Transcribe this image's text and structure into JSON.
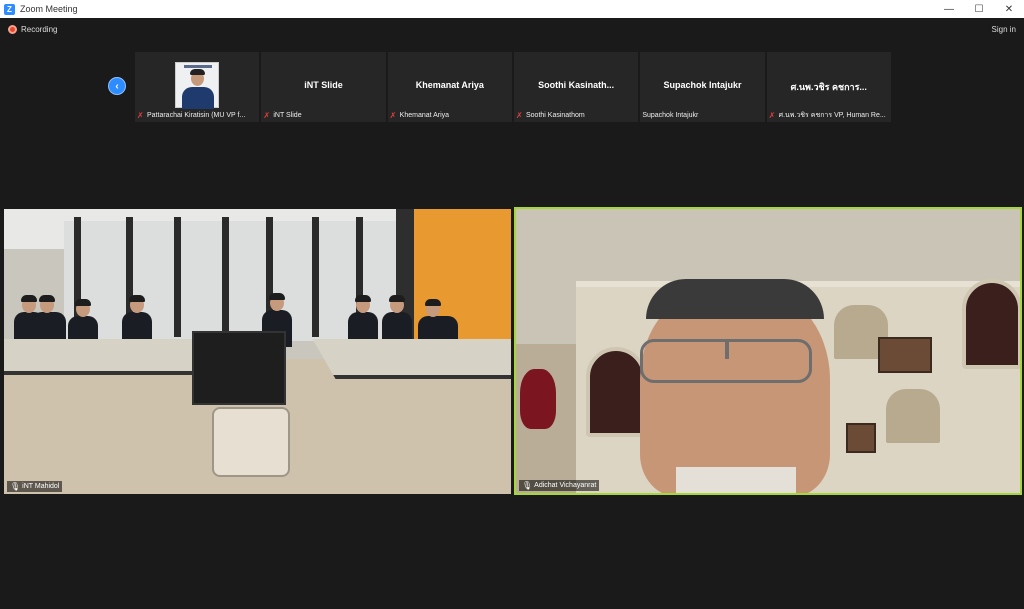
{
  "window": {
    "title": "Zoom Meeting",
    "controls": {
      "minimize": "—",
      "maximize": "☐",
      "close": "✕"
    }
  },
  "topbar": {
    "recording_label": "Recording",
    "sign_in_label": "Sign in"
  },
  "thumbnails": [
    {
      "name": "",
      "caption": "Pattarachai Kiratisin (MU VP f...",
      "muted": true,
      "has_video": true
    },
    {
      "name": "iNT Slide",
      "caption": "iNT Slide",
      "muted": true,
      "has_video": false
    },
    {
      "name": "Khemanat Ariya",
      "caption": "Khemanat Ariya",
      "muted": true,
      "has_video": false
    },
    {
      "name": "Soothi Kasinath...",
      "caption": "Soothi Kasinathom",
      "muted": true,
      "has_video": false
    },
    {
      "name": "Supachok Intajukr",
      "caption": "Supachok Intajukr",
      "muted": false,
      "has_video": false
    },
    {
      "name": "ศ.นพ.วชิร คชการ...",
      "caption": "ศ.นพ.วชิร คชการ VP, Human Re...",
      "muted": true,
      "has_video": false
    }
  ],
  "videos": {
    "left": {
      "label": "iNT Mahidol"
    },
    "right": {
      "label": "Adichat Vichayanrat",
      "active_speaker": true
    }
  },
  "colors": {
    "accent": "#2d8cff",
    "active_speaker_border": "#a5d63a",
    "recording_red": "#e8482e",
    "muted_red": "#e03e3e"
  },
  "icons": {
    "app": "zoom-logo-icon",
    "prev": "chevron-left-icon",
    "muted": "mic-muted-icon",
    "mic": "mic-icon",
    "recording": "record-dot-icon"
  }
}
